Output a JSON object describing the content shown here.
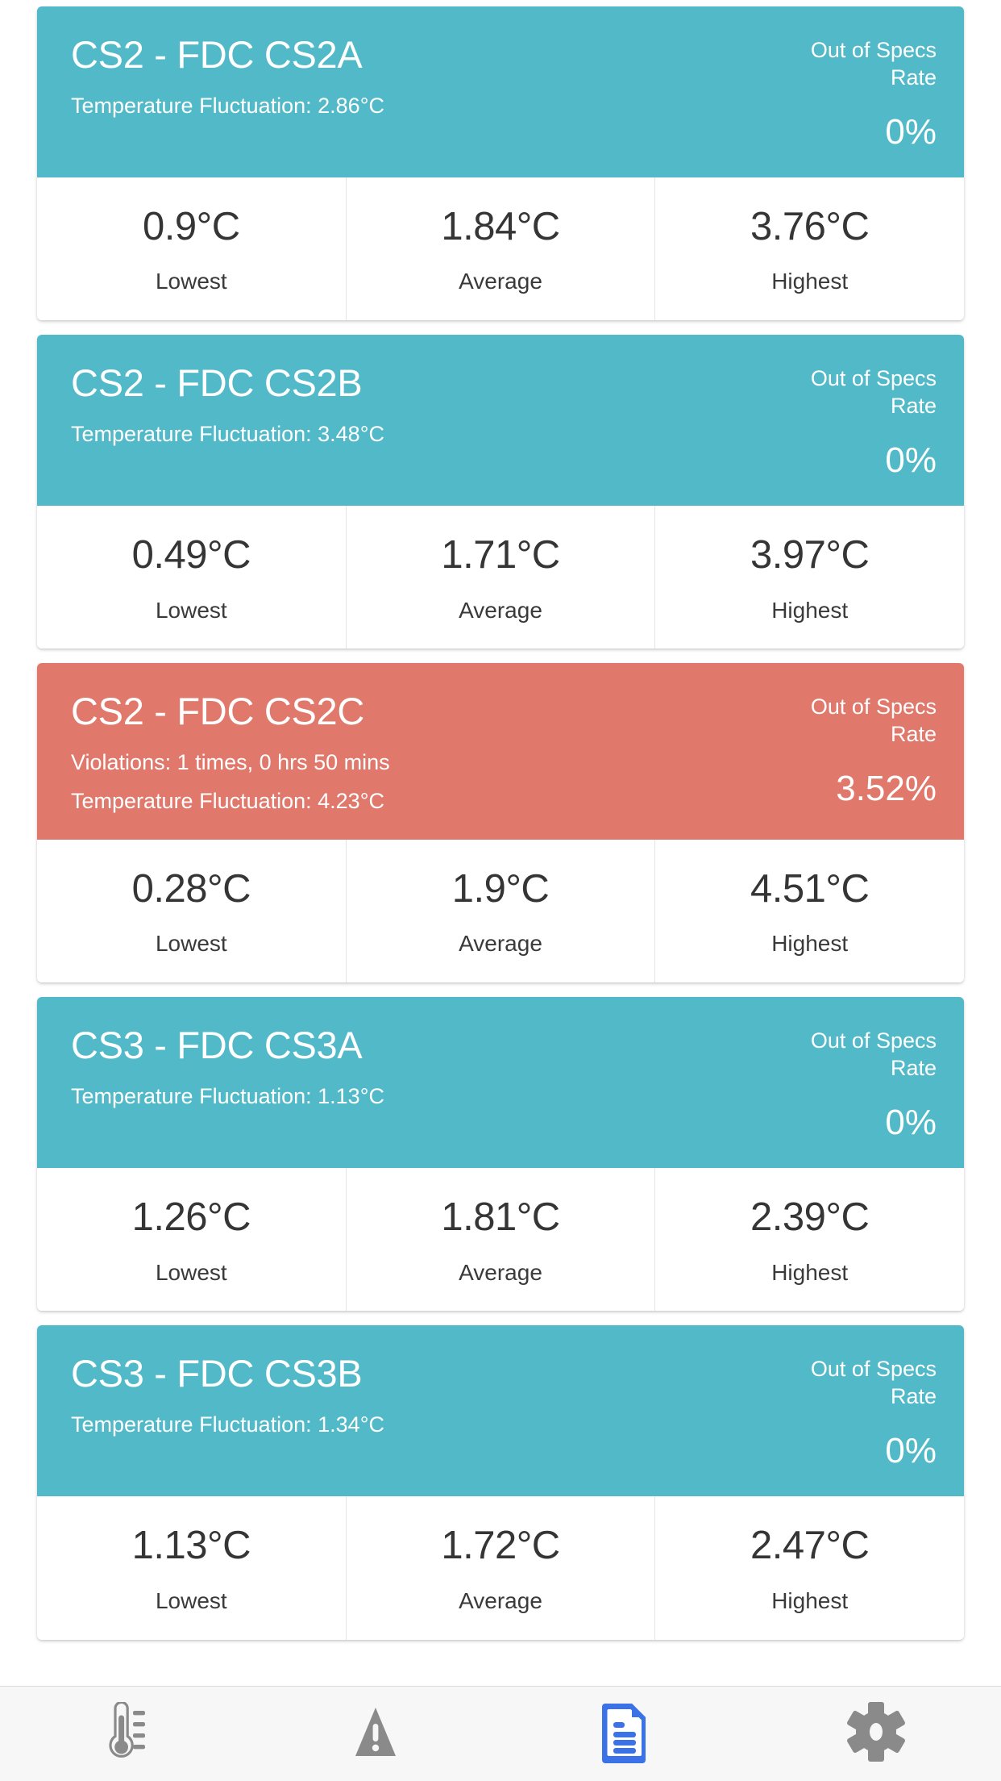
{
  "theme": {
    "ok_color": "#51B9C7",
    "alert_color": "#E0786B",
    "page_background": "#FFFFFF",
    "tabbar_background": "#F7F7F7",
    "active_tab_color": "#3B72E8",
    "inactive_tab_color": "#8A8A8A",
    "stat_value_color": "#353535"
  },
  "labels": {
    "out_of_specs_rate": "Out of Specs Rate",
    "lowest": "Lowest",
    "average": "Average",
    "highest": "Highest"
  },
  "cards": [
    {
      "title": "CS2 - FDC CS2A",
      "status": "ok",
      "violations": null,
      "fluctuation": "Temperature Fluctuation: 2.86°C",
      "oos_label": "Out of Specs Rate",
      "oos_value": "0%",
      "stats": [
        {
          "value": "0.9°C",
          "label": "Lowest"
        },
        {
          "value": "1.84°C",
          "label": "Average"
        },
        {
          "value": "3.76°C",
          "label": "Highest"
        }
      ]
    },
    {
      "title": "CS2 - FDC CS2B",
      "status": "ok",
      "violations": null,
      "fluctuation": "Temperature Fluctuation: 3.48°C",
      "oos_label": "Out of Specs Rate",
      "oos_value": "0%",
      "stats": [
        {
          "value": "0.49°C",
          "label": "Lowest"
        },
        {
          "value": "1.71°C",
          "label": "Average"
        },
        {
          "value": "3.97°C",
          "label": "Highest"
        }
      ]
    },
    {
      "title": "CS2 - FDC CS2C",
      "status": "alert",
      "violations": "Violations: 1 times, 0 hrs 50 mins",
      "fluctuation": "Temperature Fluctuation: 4.23°C",
      "oos_label": "Out of Specs Rate",
      "oos_value": "3.52%",
      "stats": [
        {
          "value": "0.28°C",
          "label": "Lowest"
        },
        {
          "value": "1.9°C",
          "label": "Average"
        },
        {
          "value": "4.51°C",
          "label": "Highest"
        }
      ]
    },
    {
      "title": "CS3 - FDC CS3A",
      "status": "ok",
      "violations": null,
      "fluctuation": "Temperature Fluctuation: 1.13°C",
      "oos_label": "Out of Specs Rate",
      "oos_value": "0%",
      "stats": [
        {
          "value": "1.26°C",
          "label": "Lowest"
        },
        {
          "value": "1.81°C",
          "label": "Average"
        },
        {
          "value": "2.39°C",
          "label": "Highest"
        }
      ]
    },
    {
      "title": "CS3 - FDC CS3B",
      "status": "ok",
      "violations": null,
      "fluctuation": "Temperature Fluctuation: 1.34°C",
      "oos_label": "Out of Specs Rate",
      "oos_value": "0%",
      "stats": [
        {
          "value": "1.13°C",
          "label": "Lowest"
        },
        {
          "value": "1.72°C",
          "label": "Average"
        },
        {
          "value": "2.47°C",
          "label": "Highest"
        }
      ]
    }
  ],
  "tabbar": {
    "items": [
      {
        "icon": "thermometer-icon",
        "active": false
      },
      {
        "icon": "warning-triangle-icon",
        "active": false
      },
      {
        "icon": "document-report-icon",
        "active": true
      },
      {
        "icon": "gear-settings-icon",
        "active": false
      }
    ]
  }
}
